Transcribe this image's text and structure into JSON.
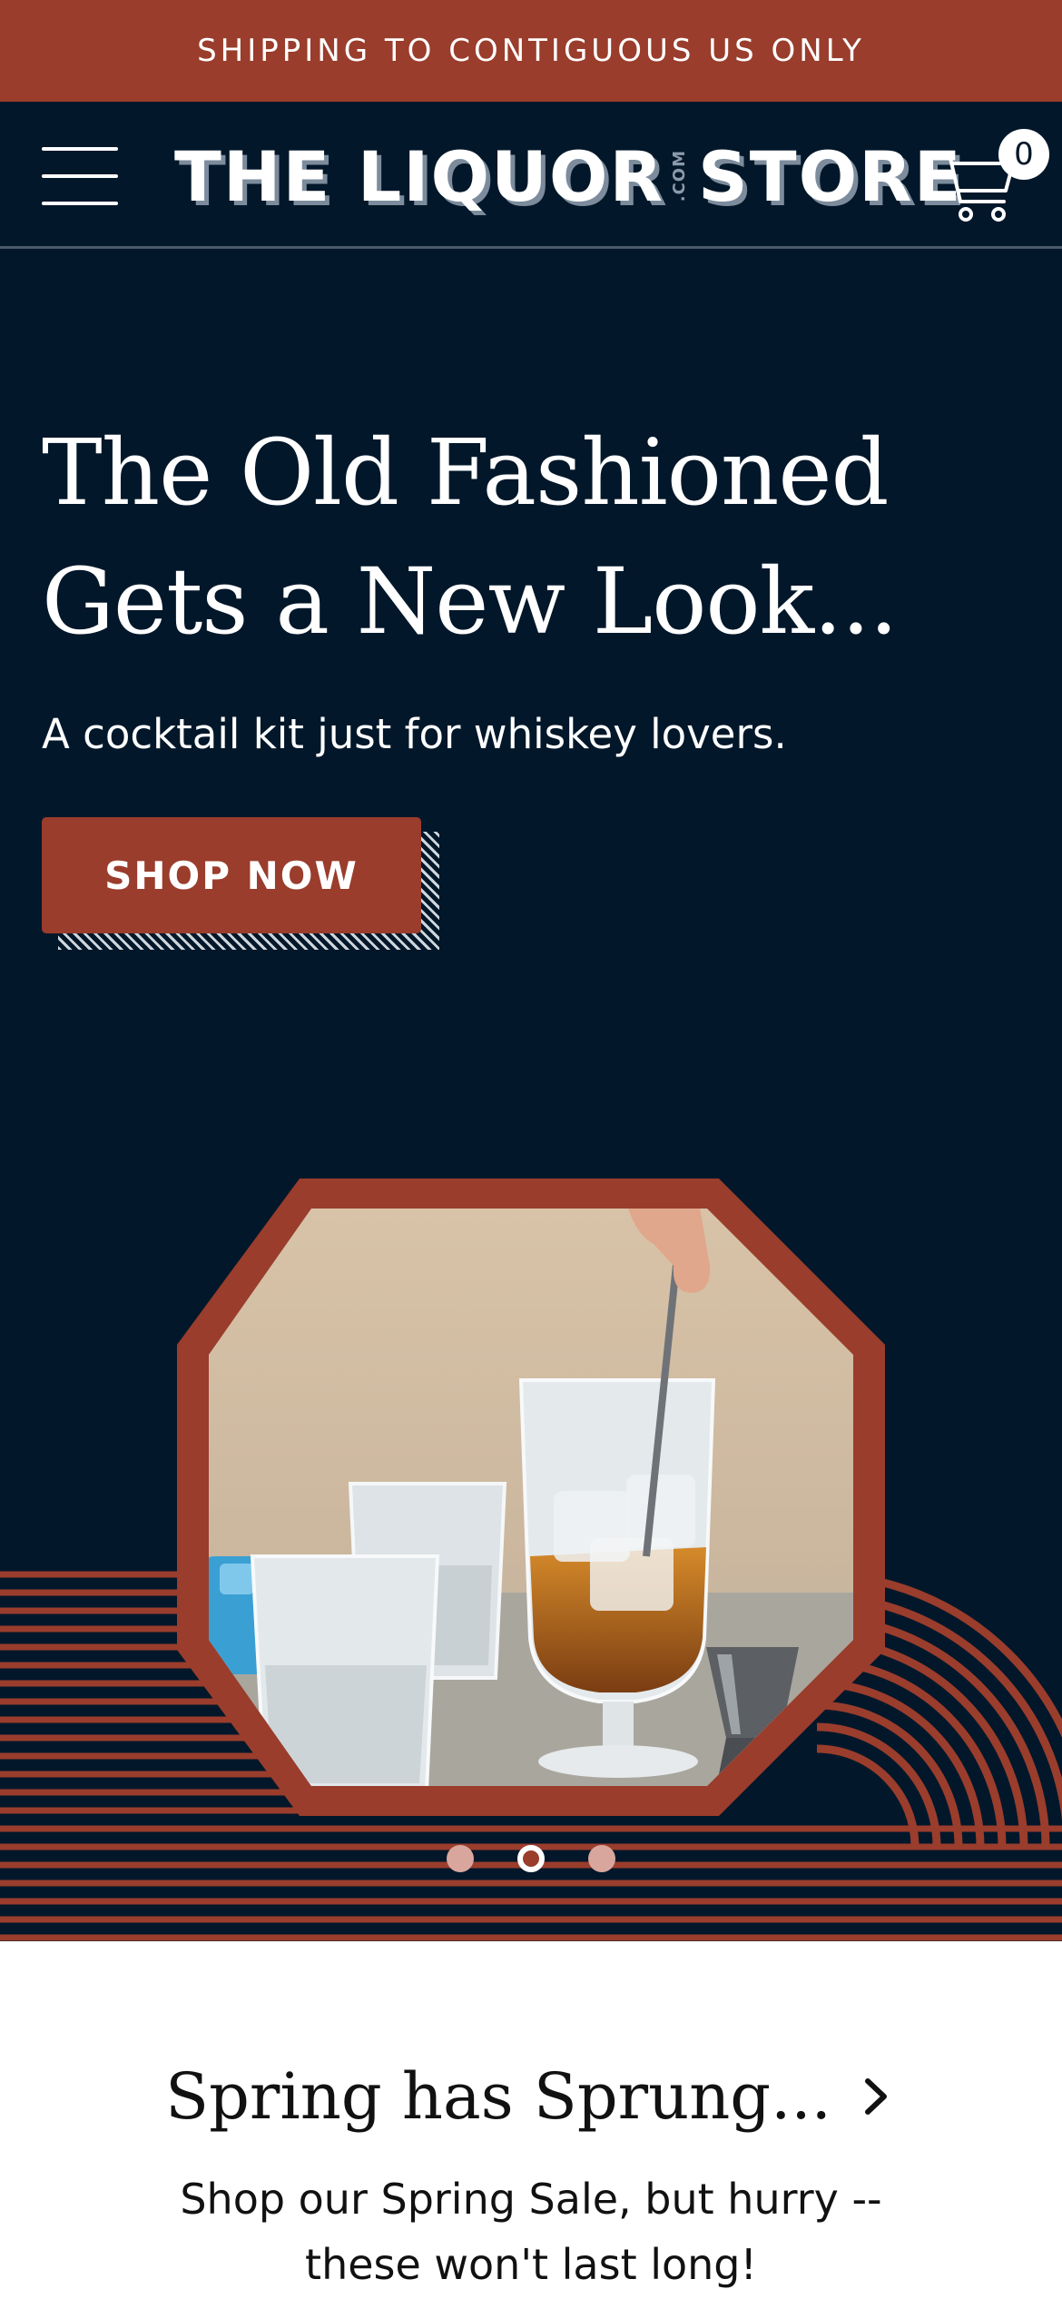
{
  "announcement": {
    "text": "SHIPPING TO CONTIGUOUS US ONLY"
  },
  "header": {
    "logo_left": "THE LIQUOR",
    "logo_com": ".COM",
    "logo_right": "STORE",
    "cart_count": "0"
  },
  "hero": {
    "title": "The Old Fashioned Gets a New Look...",
    "subtitle": "A cocktail kit just for whiskey lovers.",
    "cta_label": "SHOP NOW",
    "slides_total": 3,
    "active_slide": 2
  },
  "promo": {
    "title": "Spring has Sprung...",
    "text": "Shop our Spring Sale, but hurry -- these won't last long!"
  },
  "colors": {
    "brand_rust": "#9a3d2c",
    "navy": "#02172a",
    "white": "#ffffff"
  },
  "icons": [
    "menu-icon",
    "cart-icon",
    "chevron-right-icon"
  ]
}
